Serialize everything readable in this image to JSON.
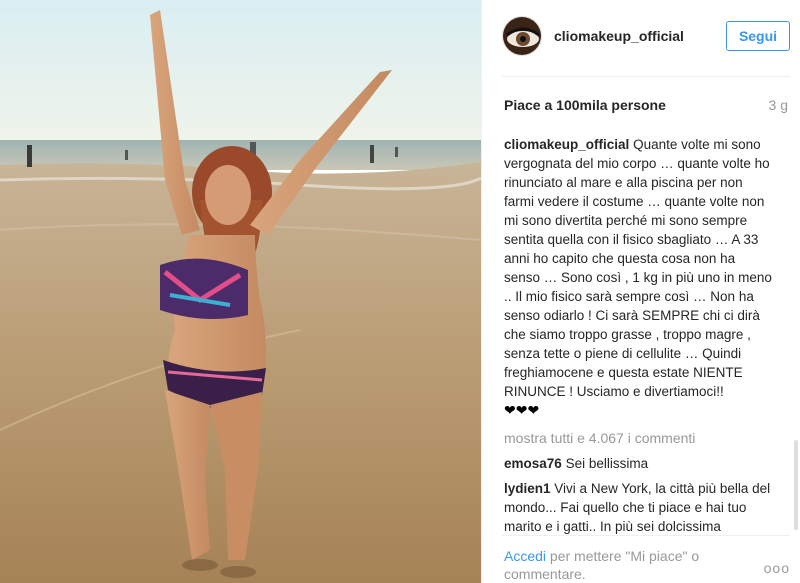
{
  "post": {
    "username": "cliomakeup_official",
    "follow_label": "Segui",
    "likes": "Piace a 100mila persone",
    "time": "3 g",
    "caption_user": "cliomakeup_official",
    "caption_text": "Quante volte mi sono vergognata del mio corpo … quante volte ho rinunciato al mare e alla piscina per non farmi vedere il costume … quante volte non mi sono divertita perché mi sono sempre sentita quella con il fisico sbagliato … A 33 anni ho capito che questa cosa non ha senso … Sono così , 1 kg in più uno in meno .. Il mio fisico sarà sempre così … Non ha senso odiarlo ! Ci sarà SEMPRE chi ci dirà che siamo troppo grasse , troppo magre , senza tette o piene di cellulite … Quindi freghiamocene e questa estate NIENTE RINUNCE ! Usciamo e divertiamoci!!",
    "caption_hearts": "❤❤❤",
    "view_all": "mostra tutti e 4.067 i commenti",
    "comments": [
      {
        "user": "emosa76",
        "text": "Sei bellissima"
      },
      {
        "user": "lydien1",
        "text": "Vivi a New York, la città più bella del mondo... Fai quello che ti piace e hai tuo marito e i gatti.. In più sei dolcissima"
      }
    ],
    "footer_link": "Accedi",
    "footer_text": "per mettere \"Mi piace\" o commentare.",
    "more_label": "ooo"
  },
  "colors": {
    "accent": "#3897f0",
    "muted": "#999999",
    "text": "#262626"
  },
  "icons": {
    "avatar": "eye-avatar-icon",
    "more": "more-options-icon"
  }
}
